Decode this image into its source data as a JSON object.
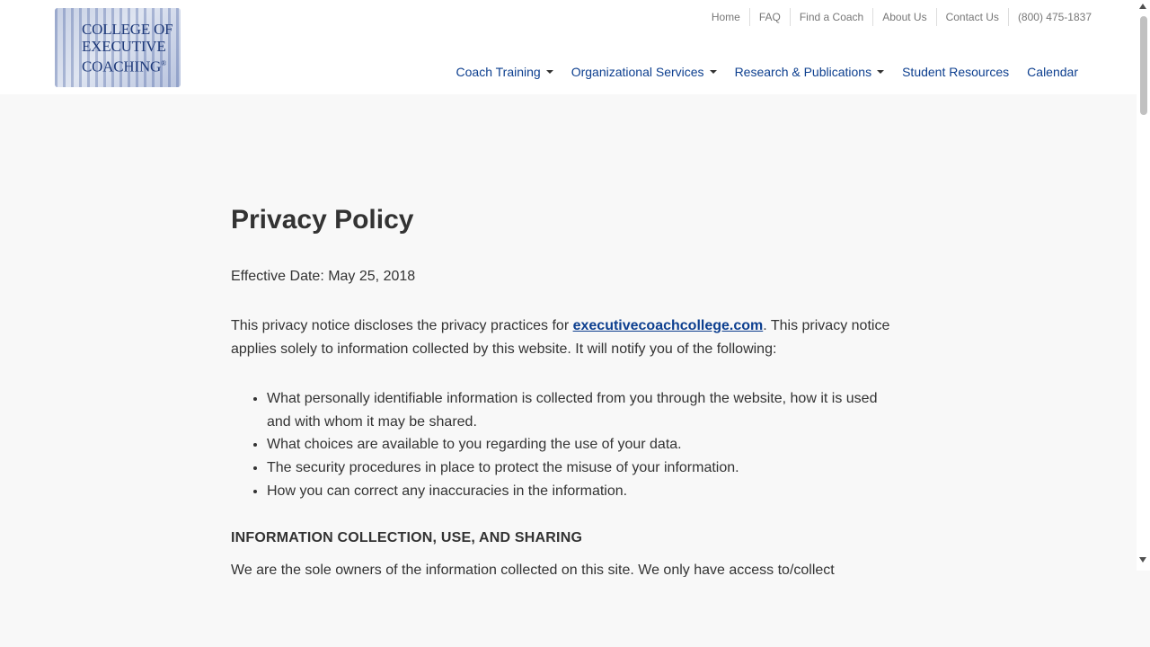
{
  "header": {
    "logo": {
      "lines": [
        "COLLEGE OF",
        "EXECUTIVE",
        "COACHING"
      ],
      "registered": "®"
    },
    "utility_nav": [
      "Home",
      "FAQ",
      "Find a Coach",
      "About Us",
      "Contact Us",
      "(800) 475-1837"
    ],
    "main_nav": [
      {
        "label": "Coach Training",
        "dropdown": true
      },
      {
        "label": "Organizational Services",
        "dropdown": true
      },
      {
        "label": "Research & Publications",
        "dropdown": true
      },
      {
        "label": "Student Resources",
        "dropdown": false
      },
      {
        "label": "Calendar",
        "dropdown": false
      }
    ]
  },
  "page": {
    "title": "Privacy Policy",
    "effective_date": "Effective Date: May 25, 2018",
    "intro": {
      "before_link": "This privacy notice discloses the privacy practices for ",
      "link": "executivecoachcollege.com",
      "after_link": ". This privacy notice applies solely to information collected by this website. It will notify you of the following:"
    },
    "bullets": [
      "What personally identifiable information is collected from you through the website, how it is used and with whom it may be shared.",
      "What choices are available to you regarding the use of your data.",
      "The security procedures in place to protect the misuse of your information.",
      "How you can correct any inaccuracies in the information."
    ],
    "section_heading": "INFORMATION COLLECTION, USE, AND SHARING",
    "section_text_partial": "We are the sole owners of the information collected on this site. We only have access to/collect"
  },
  "colors": {
    "nav_link": "#0d3f8f",
    "utility_text": "#777777",
    "body_text": "#333333",
    "page_bg": "#f8f8f8",
    "header_bg": "#ffffff"
  },
  "icons": [
    "caret-down-icon",
    "scroll-up-arrow-icon",
    "scroll-down-arrow-icon"
  ]
}
